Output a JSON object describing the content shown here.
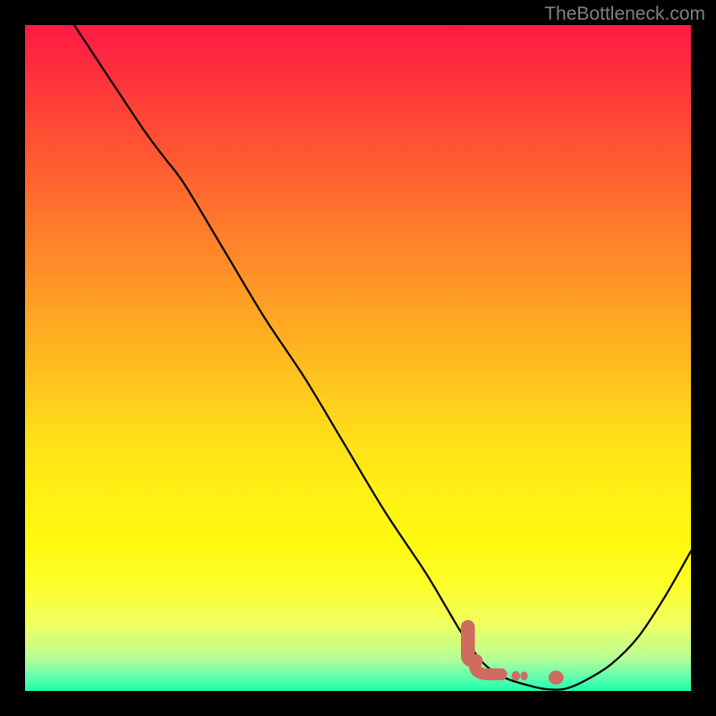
{
  "watermark": "TheBottleneck.com",
  "colors": {
    "background": "#000000",
    "gradient_top": "#ff1a44",
    "gradient_bottom": "#1effa8",
    "curve": "#000000",
    "marker": "#cf6b61",
    "watermark": "#808080"
  },
  "chart_data": {
    "type": "line",
    "title": "",
    "xlabel": "",
    "ylabel": "",
    "xlim": [
      0,
      100
    ],
    "ylim": [
      0,
      100
    ],
    "grid": false,
    "legend": false,
    "x": [
      0,
      6,
      12,
      18,
      21,
      24,
      30,
      36,
      42,
      48,
      54,
      60,
      63,
      66,
      69,
      72,
      75,
      78,
      81,
      84,
      88,
      92,
      96,
      100
    ],
    "values": [
      110,
      102,
      93,
      84,
      80,
      76,
      66,
      56,
      47,
      37,
      27,
      18,
      13,
      8,
      4,
      2,
      1,
      0.3,
      0.3,
      1.5,
      4,
      8,
      14,
      21
    ],
    "annotations": [
      {
        "type": "marker",
        "x_range": [
          65.5,
          67.5
        ],
        "y_range": [
          4.5,
          10
        ],
        "shape": "vertical-blob"
      },
      {
        "type": "marker",
        "x_range": [
          67.5,
          71.5
        ],
        "y_range": [
          2.5,
          4.5
        ],
        "shape": "hook"
      },
      {
        "type": "marker",
        "x_range": [
          73.0,
          75.5
        ],
        "y_range": [
          1.5,
          3.0
        ],
        "shape": "dot-pair"
      },
      {
        "type": "marker",
        "x_range": [
          78.5,
          81.0
        ],
        "y_range": [
          1.0,
          3.0
        ],
        "shape": "dot"
      }
    ]
  }
}
